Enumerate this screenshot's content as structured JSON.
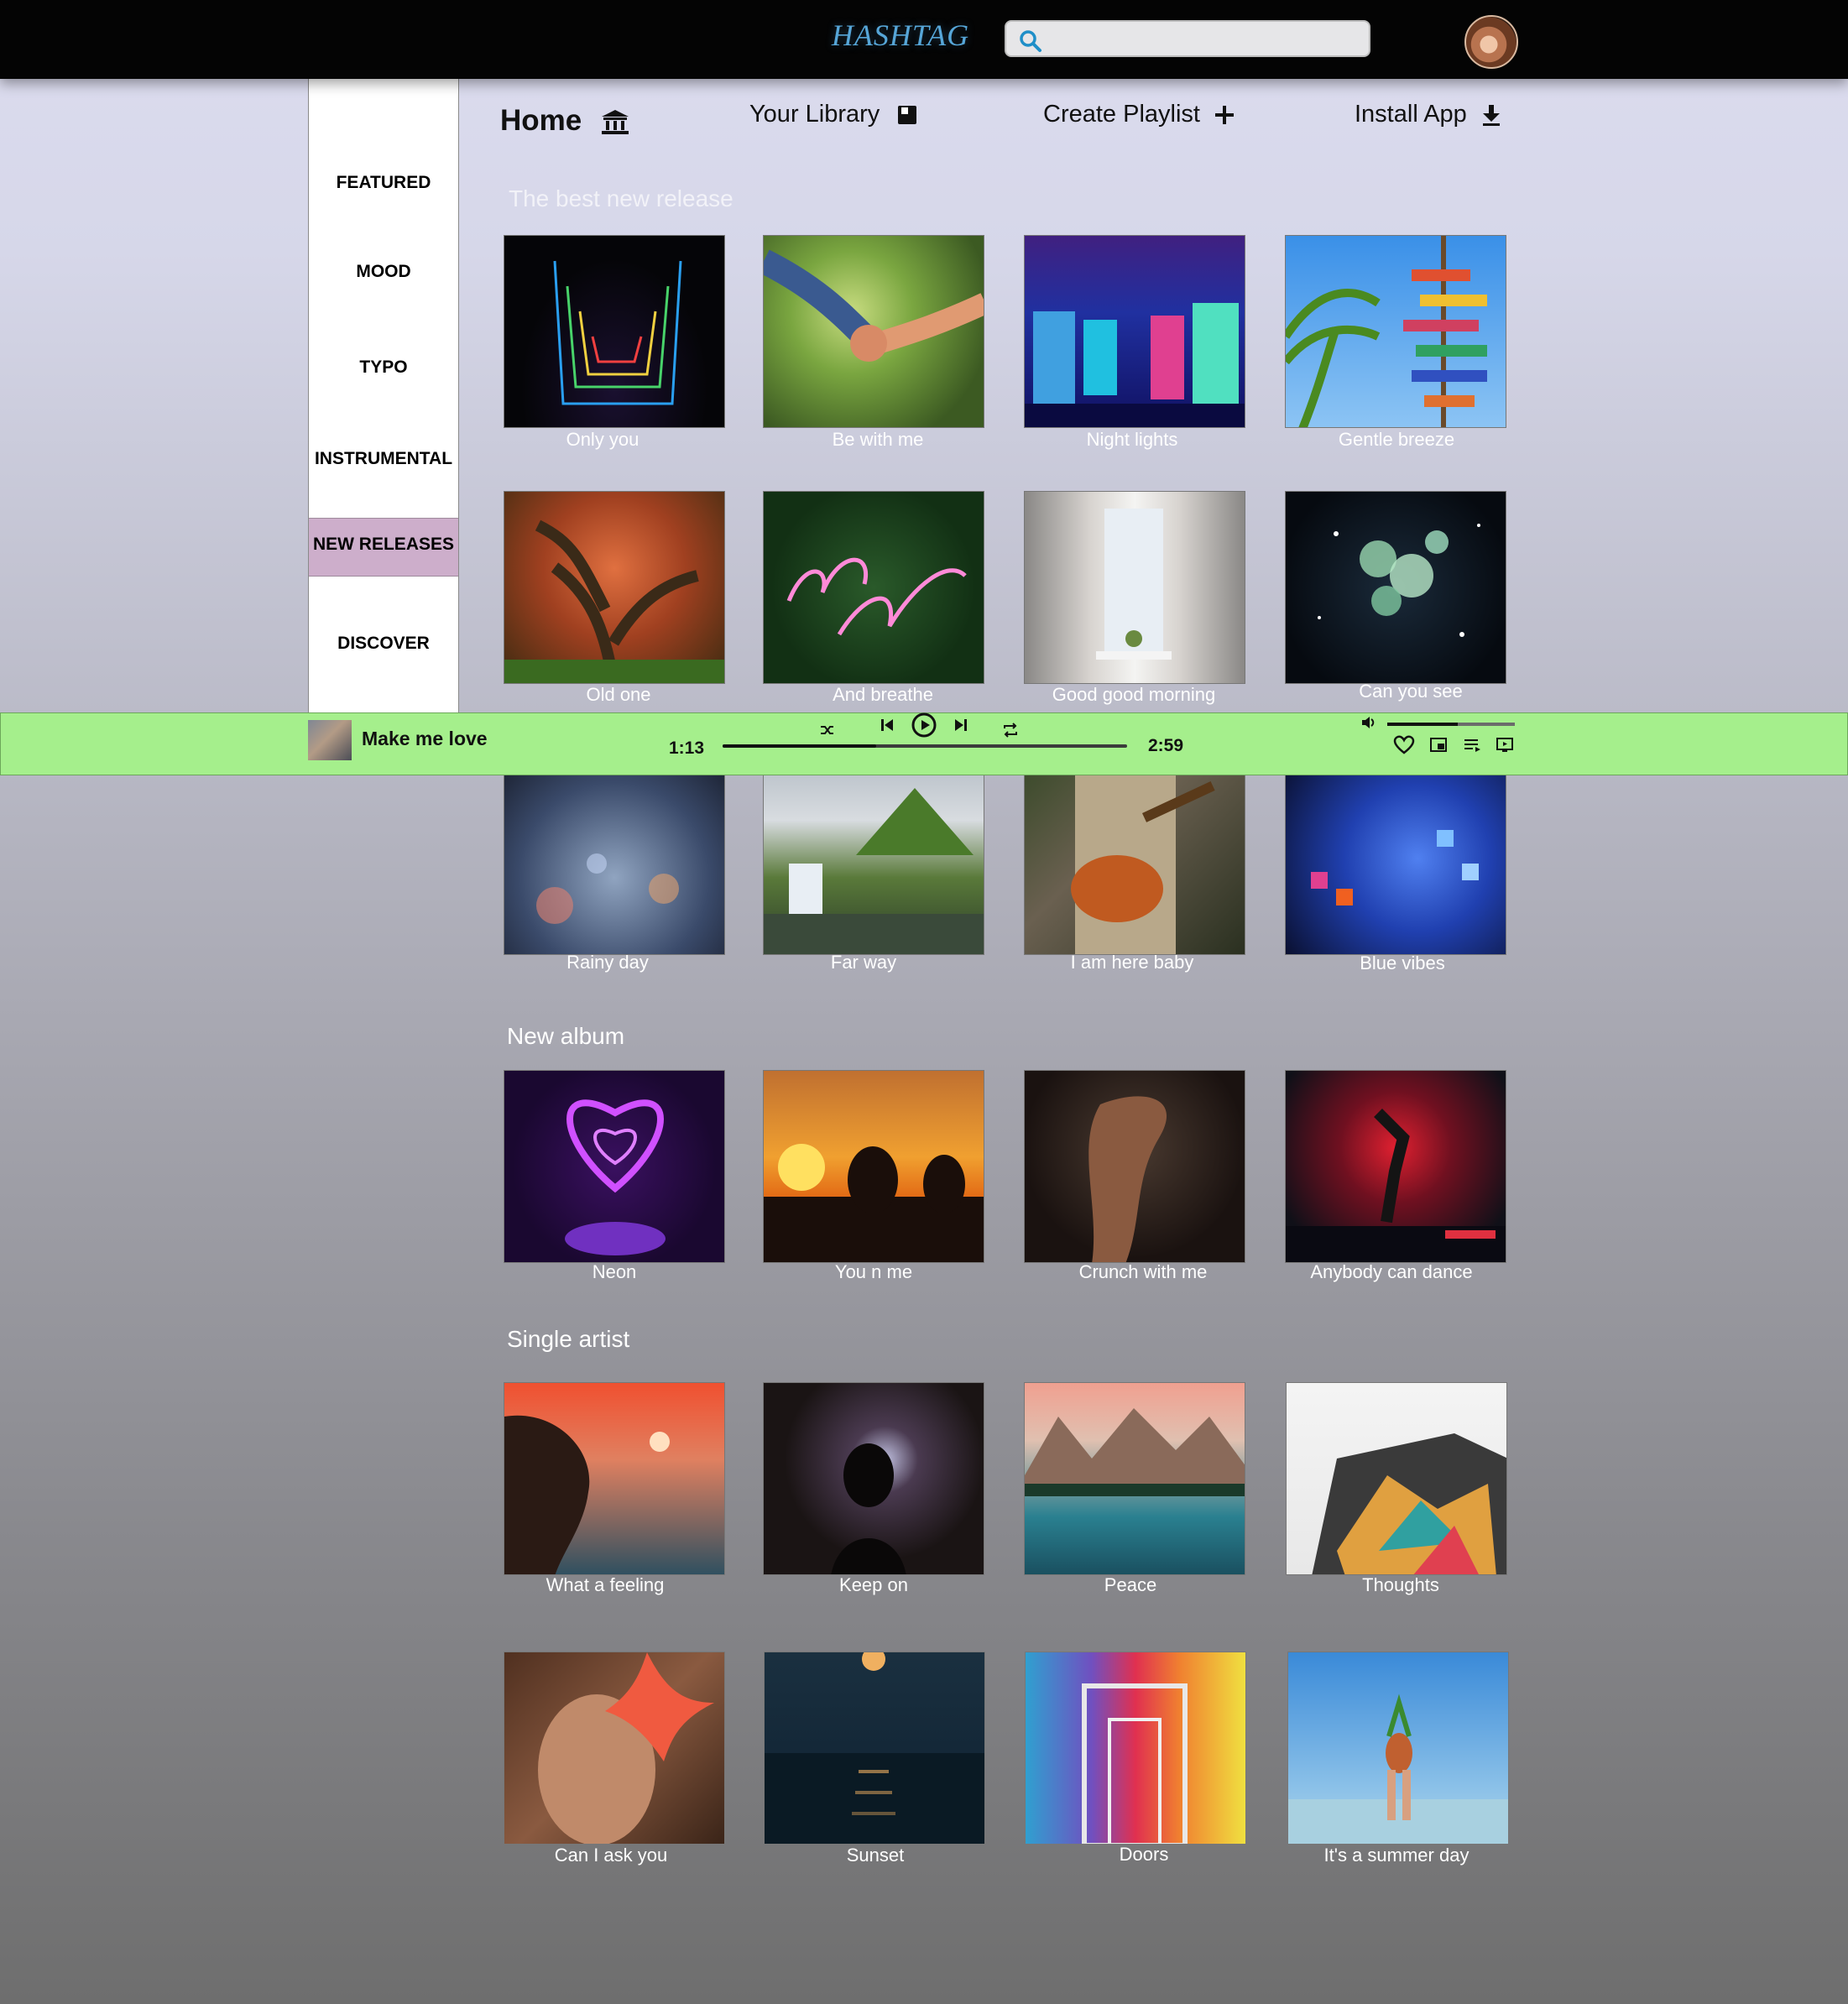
{
  "app": {
    "logo": "HASHTAG"
  },
  "search": {
    "placeholder": "",
    "value": ""
  },
  "nav": {
    "home": "Home",
    "library": "Your Library",
    "create_playlist": "Create Playlist",
    "install_app": "Install App"
  },
  "sidebar": {
    "items": [
      {
        "label": "FEATURED"
      },
      {
        "label": "MOOD"
      },
      {
        "label": "TYPO"
      },
      {
        "label": "INSTRUMENTAL"
      },
      {
        "label": "NEW RELEASES",
        "active": true
      },
      {
        "label": "DISCOVER"
      }
    ]
  },
  "sections": {
    "best_new_release": {
      "title": "The best new release",
      "items": [
        {
          "caption": "Only you"
        },
        {
          "caption": "Be with me"
        },
        {
          "caption": "Night lights"
        },
        {
          "caption": "Gentle breeze"
        },
        {
          "caption": "Old one"
        },
        {
          "caption": "And breathe"
        },
        {
          "caption": "Good good morning"
        },
        {
          "caption": "Can you see"
        },
        {
          "caption": "Rainy day"
        },
        {
          "caption": "Far way"
        },
        {
          "caption": "I am here baby"
        },
        {
          "caption": "Blue vibes"
        }
      ]
    },
    "new_album": {
      "title": "New album",
      "items": [
        {
          "caption": "Neon"
        },
        {
          "caption": "You n me"
        },
        {
          "caption": "Crunch with me"
        },
        {
          "caption": "Anybody can dance"
        }
      ]
    },
    "single_artist": {
      "title": "Single artist",
      "items": [
        {
          "caption": "What a feeling"
        },
        {
          "caption": "Keep on"
        },
        {
          "caption": "Peace"
        },
        {
          "caption": "Thoughts"
        },
        {
          "caption": "Can I ask you"
        },
        {
          "caption": "Sunset"
        },
        {
          "caption": "Doors"
        },
        {
          "caption": "It's a summer day"
        }
      ]
    }
  },
  "player": {
    "song": "Make me love",
    "elapsed": "1:13",
    "duration": "2:59",
    "progress": 0.38,
    "volume": 0.55
  },
  "colors": {
    "topbar": "#040404",
    "player_bg": "#a5ef8c",
    "sidebar_active": "#cdaecb",
    "logo": "#56a6d8"
  }
}
